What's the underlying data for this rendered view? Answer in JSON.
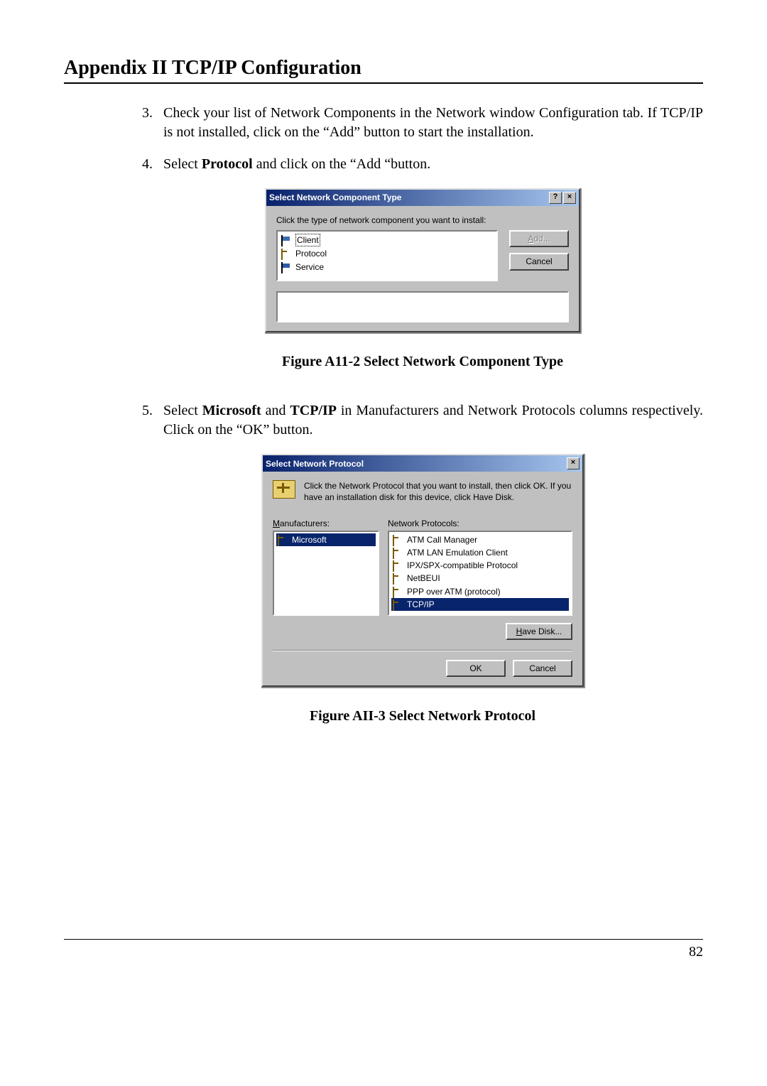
{
  "page": {
    "header": "Appendix II   TCP/IP Configuration",
    "page_number": "82"
  },
  "steps": [
    {
      "num": "3.",
      "text": "Check your list of Network Components in the Network window Configuration tab. If TCP/IP is not installed, click on the “Add” button to start the installation."
    },
    {
      "num": "4.",
      "text_pre": "Select ",
      "bold": "Protocol",
      "text_post": " and click on the “Add “button."
    },
    {
      "num": "5.",
      "text_pre": "Select ",
      "bold1": "Microsoft",
      "mid": " and ",
      "bold2": "TCP/IP",
      "text_post": " in Manufacturers and Network Protocols columns respectively. Click on the “OK” button."
    }
  ],
  "captions": {
    "fig1": "Figure A11-2  Select Network Component Type",
    "fig2": "Figure AII-3   Select Network Protocol"
  },
  "dialog1": {
    "title": "Select Network Component Type",
    "instruction": "Click the type of network component you want to install:",
    "items": [
      "Client",
      "Protocol",
      "Service"
    ],
    "add_label": "Add...",
    "cancel_label": "Cancel"
  },
  "dialog2": {
    "title": "Select Network Protocol",
    "instruction": "Click the Network Protocol that you want to install, then click OK. If you have an installation disk for this device, click Have Disk.",
    "mfr_label": "Manufacturers:",
    "prot_label": "Network Protocols:",
    "manufacturers": [
      "Microsoft"
    ],
    "protocols": [
      "ATM Call Manager",
      "ATM LAN Emulation Client",
      "IPX/SPX-compatible Protocol",
      "NetBEUI",
      "PPP over ATM (protocol)",
      "TCP/IP"
    ],
    "have_disk": "Have Disk...",
    "ok": "OK",
    "cancel": "Cancel"
  }
}
